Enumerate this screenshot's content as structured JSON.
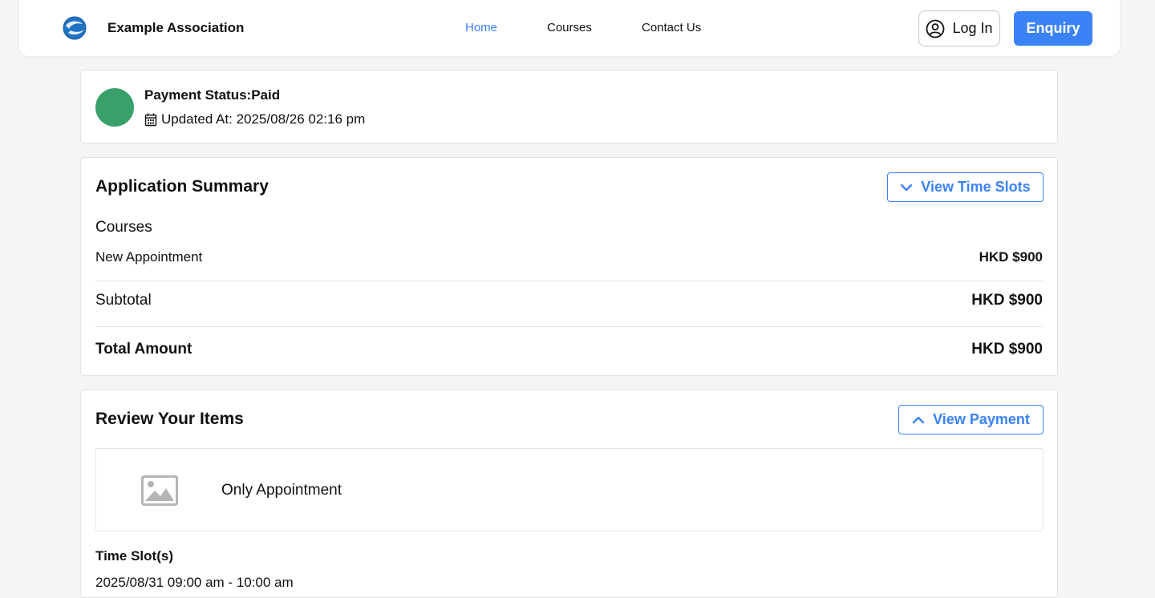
{
  "header": {
    "brand": "Example Association",
    "nav": {
      "home": "Home",
      "courses": "Courses",
      "contact": "Contact Us"
    },
    "login_label": "Log In",
    "enquiry_label": "Enquiry"
  },
  "status": {
    "title": "Payment Status:Paid",
    "updated": "Updated At: 2025/08/26 02:16 pm",
    "color": "#38a169"
  },
  "summary": {
    "title": "Application Summary",
    "toggle_label": "View Time Slots",
    "section_label": "Courses",
    "item_label": "New Appointment",
    "item_value": "HKD $900",
    "subtotal_label": "Subtotal",
    "subtotal_value": "HKD $900",
    "total_label": "Total Amount",
    "total_value": "HKD $900"
  },
  "review": {
    "title": "Review Your Items",
    "toggle_label": "View Payment",
    "item_name": "Only Appointment",
    "slots_title": "Time Slot(s)",
    "slot": "2025/08/31 09:00 am - 10:00 am"
  },
  "colors": {
    "accent": "#3b82f6",
    "background": "#f5f5f5"
  }
}
